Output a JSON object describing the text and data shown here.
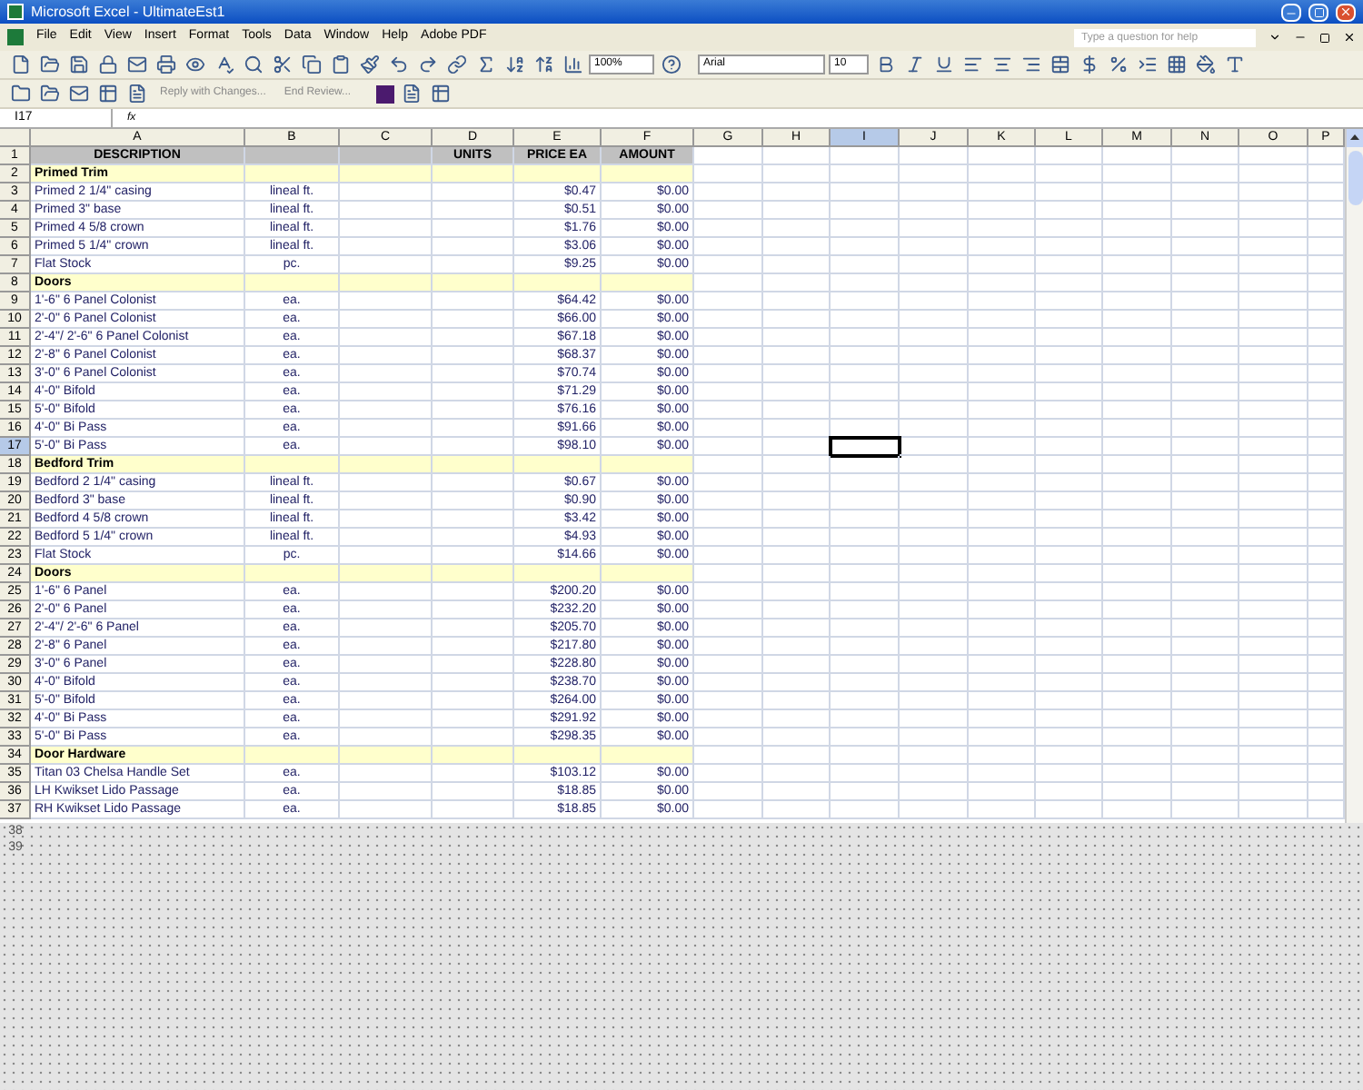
{
  "window": {
    "title": "Microsoft Excel - UltimateEst1"
  },
  "menu": [
    "File",
    "Edit",
    "View",
    "Insert",
    "Format",
    "Tools",
    "Data",
    "Window",
    "Help",
    "Adobe PDF"
  ],
  "help_box": {
    "placeholder": "Type a question for help"
  },
  "toolbar": {
    "zoom": "100%",
    "reply_button": "Reply with Changes...",
    "end_review_button": "End Review..."
  },
  "format_toolbar": {
    "font": "Arial",
    "size": "10"
  },
  "formula_bar": {
    "name_box": "I17",
    "fx": "fx"
  },
  "columns": [
    {
      "label": "A",
      "selected": false
    },
    {
      "label": "B",
      "selected": false
    },
    {
      "label": "C",
      "selected": false
    },
    {
      "label": "D",
      "selected": false
    },
    {
      "label": "E",
      "selected": false
    },
    {
      "label": "F",
      "selected": false
    },
    {
      "label": "G",
      "selected": false
    },
    {
      "label": "H",
      "selected": false
    },
    {
      "label": "I",
      "selected": true
    },
    {
      "label": "J",
      "selected": false
    },
    {
      "label": "K",
      "selected": false
    },
    {
      "label": "L",
      "selected": false
    },
    {
      "label": "M",
      "selected": false
    },
    {
      "label": "N",
      "selected": false
    },
    {
      "label": "O",
      "selected": false
    },
    {
      "label": "P",
      "selected": false
    }
  ],
  "rows": [
    {
      "number": "1",
      "kind": "header",
      "selected": false,
      "description": "DESCRIPTION",
      "units": "UNITS",
      "price": "PRICE EA",
      "amount": "AMOUNT"
    },
    {
      "number": "2",
      "kind": "section",
      "selected": false,
      "description": "Primed Trim"
    },
    {
      "number": "3",
      "kind": "item",
      "selected": false,
      "description": "Primed 2 1/4\" casing",
      "unit": "lineal ft.",
      "price": "$0.47",
      "amount": "$0.00"
    },
    {
      "number": "4",
      "kind": "item",
      "selected": false,
      "description": "Primed 3\" base",
      "unit": "lineal ft.",
      "price": "$0.51",
      "amount": "$0.00"
    },
    {
      "number": "5",
      "kind": "item",
      "selected": false,
      "description": "Primed 4 5/8 crown",
      "unit": "lineal ft.",
      "price": "$1.76",
      "amount": "$0.00"
    },
    {
      "number": "6",
      "kind": "item",
      "selected": false,
      "description": "Primed 5 1/4\" crown",
      "unit": "lineal ft.",
      "price": "$3.06",
      "amount": "$0.00"
    },
    {
      "number": "7",
      "kind": "item",
      "selected": false,
      "description": "Flat Stock",
      "unit": "pc.",
      "price": "$9.25",
      "amount": "$0.00"
    },
    {
      "number": "8",
      "kind": "section",
      "selected": false,
      "description": "Doors"
    },
    {
      "number": "9",
      "kind": "item",
      "selected": false,
      "description": "1'-6\" 6 Panel Colonist",
      "unit": "ea.",
      "price": "$64.42",
      "amount": "$0.00"
    },
    {
      "number": "10",
      "kind": "item",
      "selected": false,
      "description": "2'-0\" 6 Panel Colonist",
      "unit": "ea.",
      "price": "$66.00",
      "amount": "$0.00"
    },
    {
      "number": "11",
      "kind": "item",
      "selected": false,
      "description": "2'-4\"/ 2'-6\" 6 Panel Colonist",
      "unit": "ea.",
      "price": "$67.18",
      "amount": "$0.00"
    },
    {
      "number": "12",
      "kind": "item",
      "selected": false,
      "description": "2'-8\" 6 Panel Colonist",
      "unit": "ea.",
      "price": "$68.37",
      "amount": "$0.00"
    },
    {
      "number": "13",
      "kind": "item",
      "selected": false,
      "description": "3'-0\" 6 Panel Colonist",
      "unit": "ea.",
      "price": "$70.74",
      "amount": "$0.00"
    },
    {
      "number": "14",
      "kind": "item",
      "selected": false,
      "description": "4'-0\" Bifold",
      "unit": "ea.",
      "price": "$71.29",
      "amount": "$0.00"
    },
    {
      "number": "15",
      "kind": "item",
      "selected": false,
      "description": "5'-0\" Bifold",
      "unit": "ea.",
      "price": "$76.16",
      "amount": "$0.00"
    },
    {
      "number": "16",
      "kind": "item",
      "selected": false,
      "description": "4'-0\" Bi Pass",
      "unit": "ea.",
      "price": "$91.66",
      "amount": "$0.00"
    },
    {
      "number": "17",
      "kind": "item",
      "selected": true,
      "description": "5'-0\" Bi Pass",
      "unit": "ea.",
      "price": "$98.10",
      "amount": "$0.00"
    },
    {
      "number": "18",
      "kind": "section",
      "selected": false,
      "description": "Bedford Trim"
    },
    {
      "number": "19",
      "kind": "item",
      "selected": false,
      "description": "Bedford 2 1/4\" casing",
      "unit": "lineal ft.",
      "price": "$0.67",
      "amount": "$0.00"
    },
    {
      "number": "20",
      "kind": "item",
      "selected": false,
      "description": "Bedford 3\" base",
      "unit": "lineal ft.",
      "price": "$0.90",
      "amount": "$0.00"
    },
    {
      "number": "21",
      "kind": "item",
      "selected": false,
      "description": "Bedford 4 5/8 crown",
      "unit": "lineal ft.",
      "price": "$3.42",
      "amount": "$0.00"
    },
    {
      "number": "22",
      "kind": "item",
      "selected": false,
      "description": "Bedford 5 1/4\" crown",
      "unit": "lineal ft.",
      "price": "$4.93",
      "amount": "$0.00"
    },
    {
      "number": "23",
      "kind": "item",
      "selected": false,
      "description": "Flat Stock",
      "unit": "pc.",
      "price": "$14.66",
      "amount": "$0.00"
    },
    {
      "number": "24",
      "kind": "section",
      "selected": false,
      "description": "Doors"
    },
    {
      "number": "25",
      "kind": "item",
      "selected": false,
      "description": "1'-6\" 6 Panel",
      "unit": "ea.",
      "price": "$200.20",
      "amount": "$0.00"
    },
    {
      "number": "26",
      "kind": "item",
      "selected": false,
      "description": "2'-0\" 6 Panel",
      "unit": "ea.",
      "price": "$232.20",
      "amount": "$0.00"
    },
    {
      "number": "27",
      "kind": "item",
      "selected": false,
      "description": "2'-4\"/ 2'-6\" 6 Panel",
      "unit": "ea.",
      "price": "$205.70",
      "amount": "$0.00"
    },
    {
      "number": "28",
      "kind": "item",
      "selected": false,
      "description": "2'-8\" 6 Panel",
      "unit": "ea.",
      "price": "$217.80",
      "amount": "$0.00"
    },
    {
      "number": "29",
      "kind": "item",
      "selected": false,
      "description": "3'-0\" 6 Panel",
      "unit": "ea.",
      "price": "$228.80",
      "amount": "$0.00"
    },
    {
      "number": "30",
      "kind": "item",
      "selected": false,
      "description": "4'-0\" Bifold",
      "unit": "ea.",
      "price": "$238.70",
      "amount": "$0.00"
    },
    {
      "number": "31",
      "kind": "item",
      "selected": false,
      "description": "5'-0\" Bifold",
      "unit": "ea.",
      "price": "$264.00",
      "amount": "$0.00"
    },
    {
      "number": "32",
      "kind": "item",
      "selected": false,
      "description": "4'-0\" Bi Pass",
      "unit": "ea.",
      "price": "$291.92",
      "amount": "$0.00"
    },
    {
      "number": "33",
      "kind": "item",
      "selected": false,
      "description": "5'-0\" Bi Pass",
      "unit": "ea.",
      "price": "$298.35",
      "amount": "$0.00"
    },
    {
      "number": "34",
      "kind": "section",
      "selected": false,
      "description": "Door Hardware"
    },
    {
      "number": "35",
      "kind": "item",
      "selected": false,
      "description": "Titan 03 Chelsa Handle Set",
      "unit": "ea.",
      "price": "$103.12",
      "amount": "$0.00"
    },
    {
      "number": "36",
      "kind": "item",
      "selected": false,
      "description": "LH Kwikset Lido Passage",
      "unit": "ea.",
      "price": "$18.85",
      "amount": "$0.00"
    },
    {
      "number": "37",
      "kind": "item",
      "selected": false,
      "description": "RH Kwikset Lido Passage",
      "unit": "ea.",
      "price": "$18.85",
      "amount": "$0.00"
    }
  ],
  "hidden_row_numbers": [
    "38",
    "39"
  ]
}
